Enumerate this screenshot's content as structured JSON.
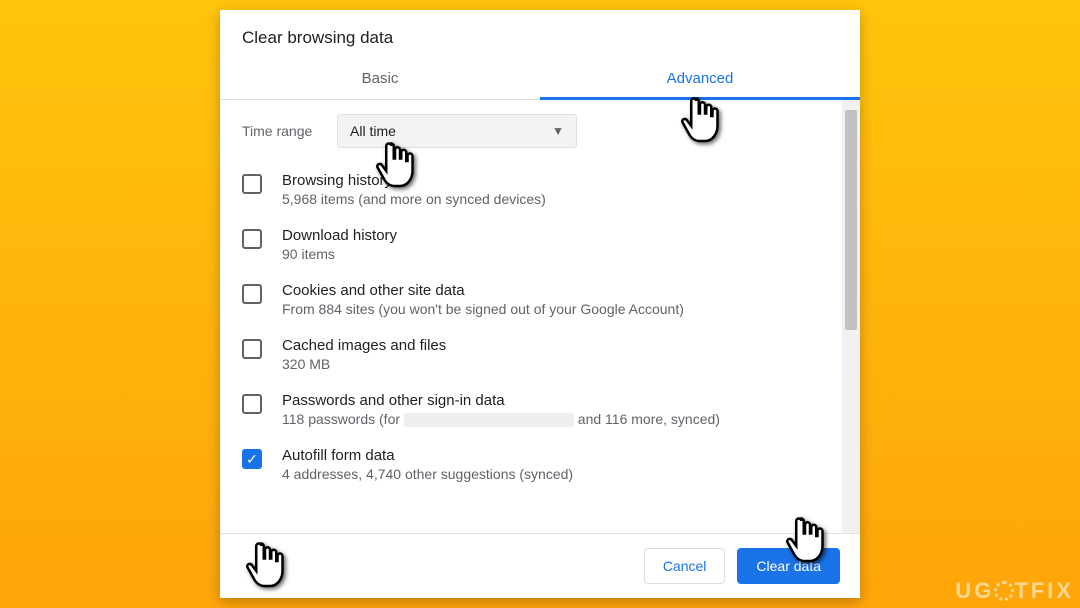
{
  "dialog": {
    "title": "Clear browsing data",
    "tabs": {
      "basic": "Basic",
      "advanced": "Advanced",
      "active": "advanced"
    },
    "time_range": {
      "label": "Time range",
      "value": "All time"
    },
    "items": [
      {
        "title": "Browsing history",
        "sub": "5,968 items (and more on synced devices)",
        "checked": false
      },
      {
        "title": "Download history",
        "sub": "90 items",
        "checked": false
      },
      {
        "title": "Cookies and other site data",
        "sub": "From 884 sites (you won't be signed out of your Google Account)",
        "checked": false
      },
      {
        "title": "Cached images and files",
        "sub": "320 MB",
        "checked": false
      },
      {
        "title": "Passwords and other sign-in data",
        "sub_prefix": "118 passwords (for ",
        "sub_suffix": " and 116 more, synced)",
        "redacted": true,
        "checked": false
      },
      {
        "title": "Autofill form data",
        "sub": "4 addresses, 4,740 other suggestions (synced)",
        "checked": true
      }
    ],
    "buttons": {
      "cancel": "Cancel",
      "clear": "Clear data"
    }
  },
  "watermark": {
    "pre": "UG",
    "post": "TFIX"
  }
}
